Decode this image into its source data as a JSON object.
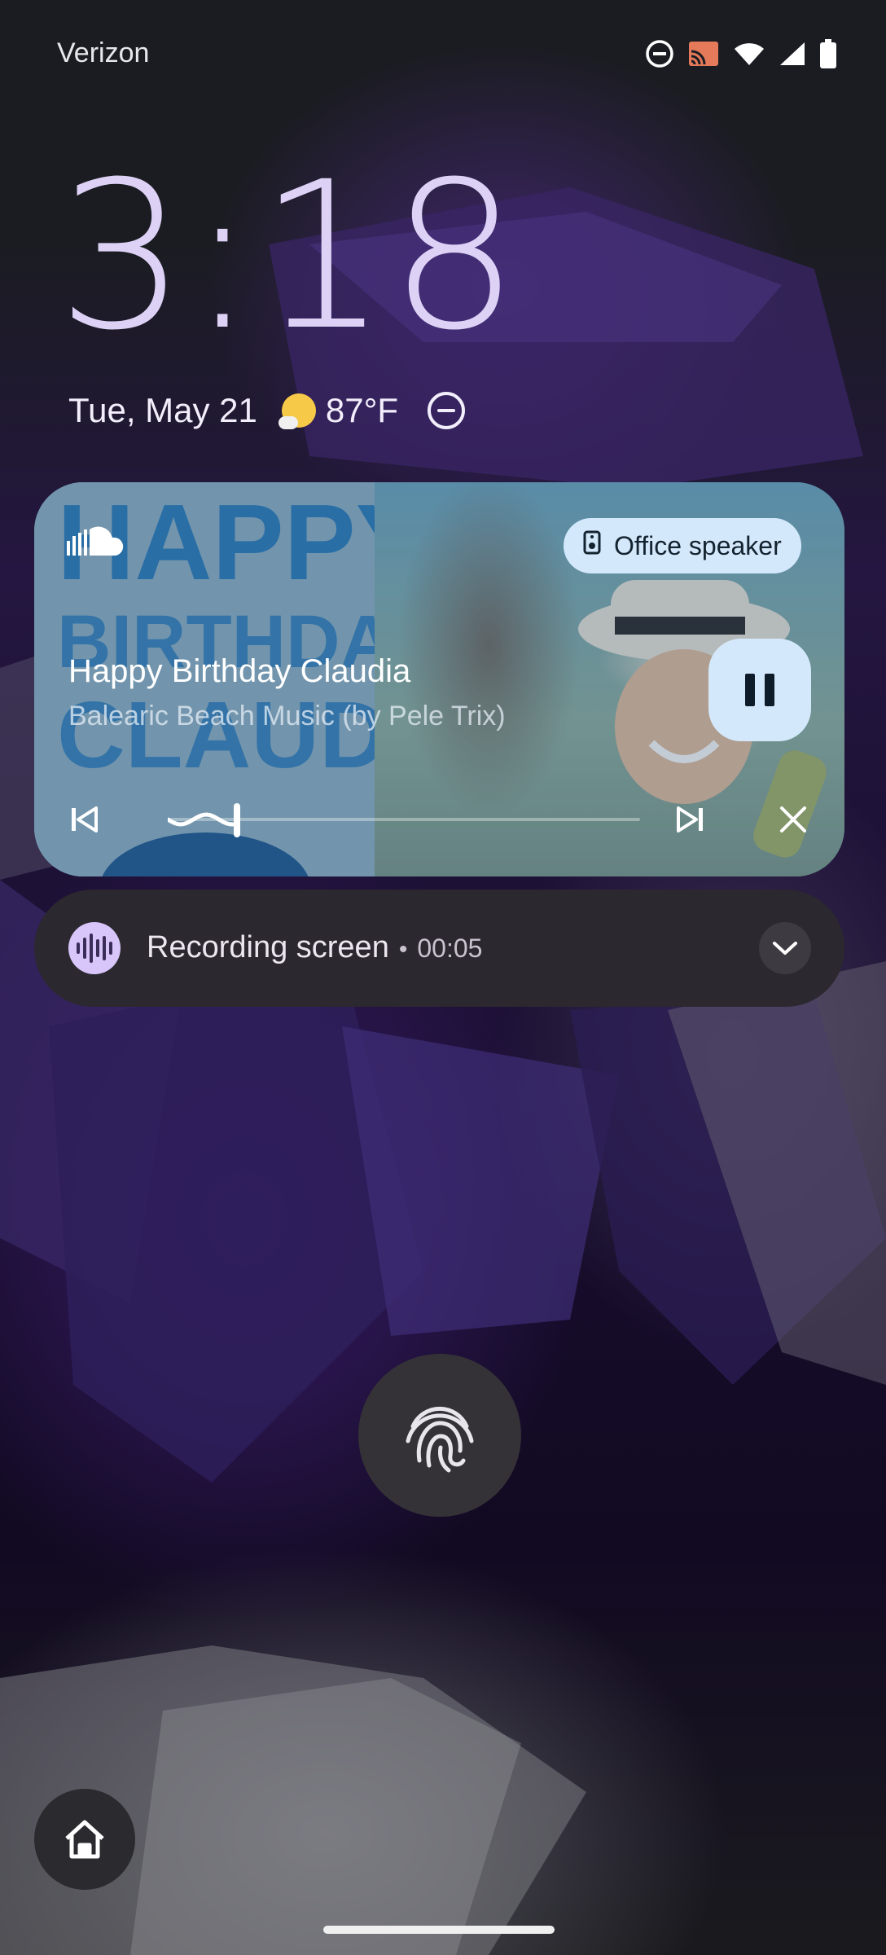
{
  "status_bar": {
    "carrier": "Verizon",
    "icons": [
      "do-not-disturb-icon",
      "cast-icon",
      "wifi-icon",
      "cell-signal-icon",
      "battery-icon"
    ]
  },
  "lockscreen": {
    "time": "3:18",
    "date": "Tue, May 21",
    "weather_icon": "partly-sunny-icon",
    "temperature": "87°F",
    "dnd_icon": "do-not-disturb-icon"
  },
  "media": {
    "app_icon": "soundcloud-icon",
    "artwork_text": [
      "HAPPY",
      "BIRTHDAY",
      "CLAUDIA"
    ],
    "output_device": "Office speaker",
    "title": "Happy Birthday Claudia",
    "artist": "Balearic Beach Music   (by Pele Trix)",
    "progress": 0.14,
    "accent_color": "#d4e8fb",
    "controls": [
      "previous-icon",
      "pause-icon",
      "next-icon",
      "close-icon"
    ]
  },
  "recording": {
    "title": "Recording screen",
    "separator": "•",
    "elapsed": "00:05",
    "icon": "sound-wave-icon",
    "accent_color": "#d8c6fa"
  },
  "bottom": {
    "fingerprint_icon": "fingerprint-icon",
    "home_icon": "home-icon"
  }
}
